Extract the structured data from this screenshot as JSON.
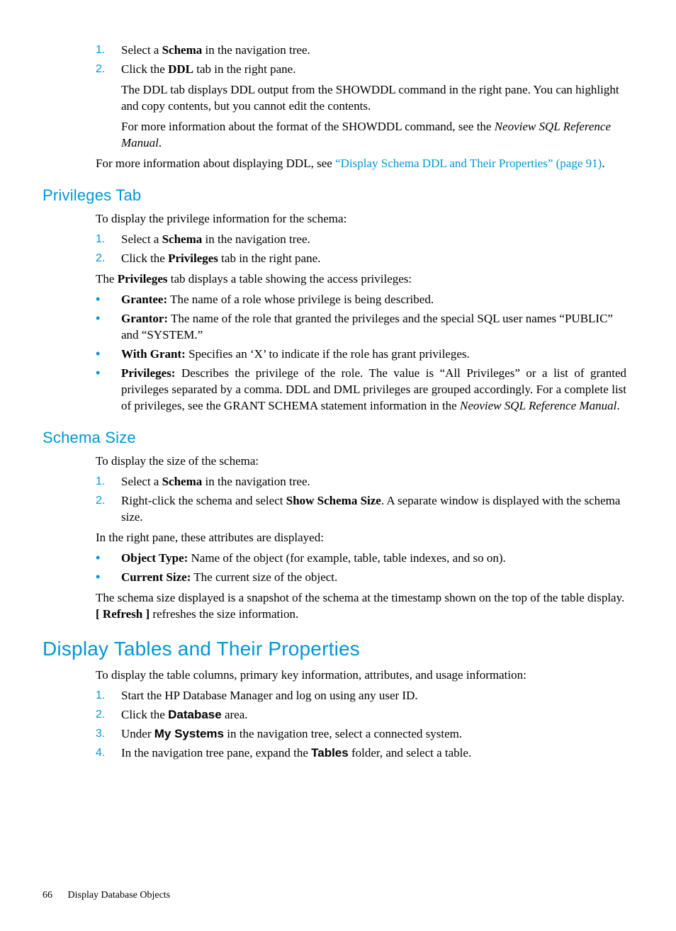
{
  "topList": {
    "item1": {
      "num": "1.",
      "text_a": "Select a ",
      "b1": "Schema",
      "text_b": " in the navigation tree."
    },
    "item2": {
      "num": "2.",
      "text_a": "Click the ",
      "b1": "DDL",
      "text_b": " tab in the right pane."
    },
    "sub1": "The DDL tab displays DDL output from the SHOWDDL command in the right pane. You can highlight and copy contents, but you cannot edit the contents.",
    "sub2_a": "For more information about the format of the SHOWDDL command, see the ",
    "sub2_i": "Neoview SQL Reference Manual",
    "sub2_b": "."
  },
  "topPara": {
    "a": "For more information about displaying DDL, see ",
    "link": "“Display Schema DDL and Their Properties” (page 91)",
    "b": "."
  },
  "privileges": {
    "heading": "Privileges Tab",
    "intro": "To display the privilege information for the schema:",
    "list": {
      "item1": {
        "num": "1.",
        "text_a": "Select a ",
        "b1": "Schema",
        "text_b": " in the navigation tree."
      },
      "item2": {
        "num": "2.",
        "text_a": "Click the ",
        "b1": "Privileges",
        "text_b": " tab in the right pane."
      }
    },
    "para2_a": "The ",
    "para2_b": "Privileges",
    "para2_c": " tab displays a table showing the access privileges:",
    "bullets": {
      "b1": {
        "label": "Grantee:",
        "text": " The name of a role whose privilege is being described."
      },
      "b2": {
        "label": "Grantor:",
        "text": " The name of the role that granted the privileges and the special SQL user names “PUBLIC” and “SYSTEM.”"
      },
      "b3": {
        "label": "With Grant:",
        "text": " Specifies an ‘X’ to indicate if the role has grant privileges."
      },
      "b4": {
        "label": "Privileges:",
        "text_a": " Describes the privilege of the role. The value is “All Privileges” or a list of granted privileges separated by a comma. DDL and DML privileges are grouped accordingly. For a complete list of privileges, see the GRANT SCHEMA statement information in the ",
        "i": "Neoview SQL Reference Manual",
        "text_b": "."
      }
    }
  },
  "schemaSize": {
    "heading": "Schema Size",
    "intro": "To display the size of the schema:",
    "list": {
      "item1": {
        "num": "1.",
        "text_a": "Select a ",
        "b1": "Schema",
        "text_b": " in the navigation tree."
      },
      "item2": {
        "num": "2.",
        "text_a": "Right-click the schema and select ",
        "b1": "Show Schema Size",
        "text_b": ". A separate window is displayed with the schema size."
      }
    },
    "para2": "In the right pane, these attributes are displayed:",
    "bullets": {
      "b1": {
        "label": "Object Type:",
        "text": " Name of the object (for example, table, table indexes, and so on)."
      },
      "b2": {
        "label": "Current Size:",
        "text": " The current size of the object."
      }
    },
    "para3_a": "The schema size displayed is a snapshot of the schema at the timestamp shown on the top of the table display. ",
    "para3_b": "[ Refresh ]",
    "para3_c": " refreshes the size information."
  },
  "displayTables": {
    "heading": "Display Tables and Their Properties",
    "intro": "To display the table columns, primary key information, attributes, and usage information:",
    "list": {
      "item1": {
        "num": "1.",
        "text": "Start the HP Database Manager and log on using any user ID."
      },
      "item2": {
        "num": "2.",
        "text_a": "Click the ",
        "b1": "Database",
        "text_b": " area."
      },
      "item3": {
        "num": "3.",
        "text_a": "Under ",
        "b1": "My Systems",
        "text_b": " in the navigation tree, select a connected system."
      },
      "item4": {
        "num": "4.",
        "text_a": "In the navigation tree pane, expand the ",
        "b1": "Tables",
        "text_b": " folder, and select a table."
      }
    }
  },
  "footer": {
    "pageNum": "66",
    "chapter": "Display Database Objects"
  }
}
